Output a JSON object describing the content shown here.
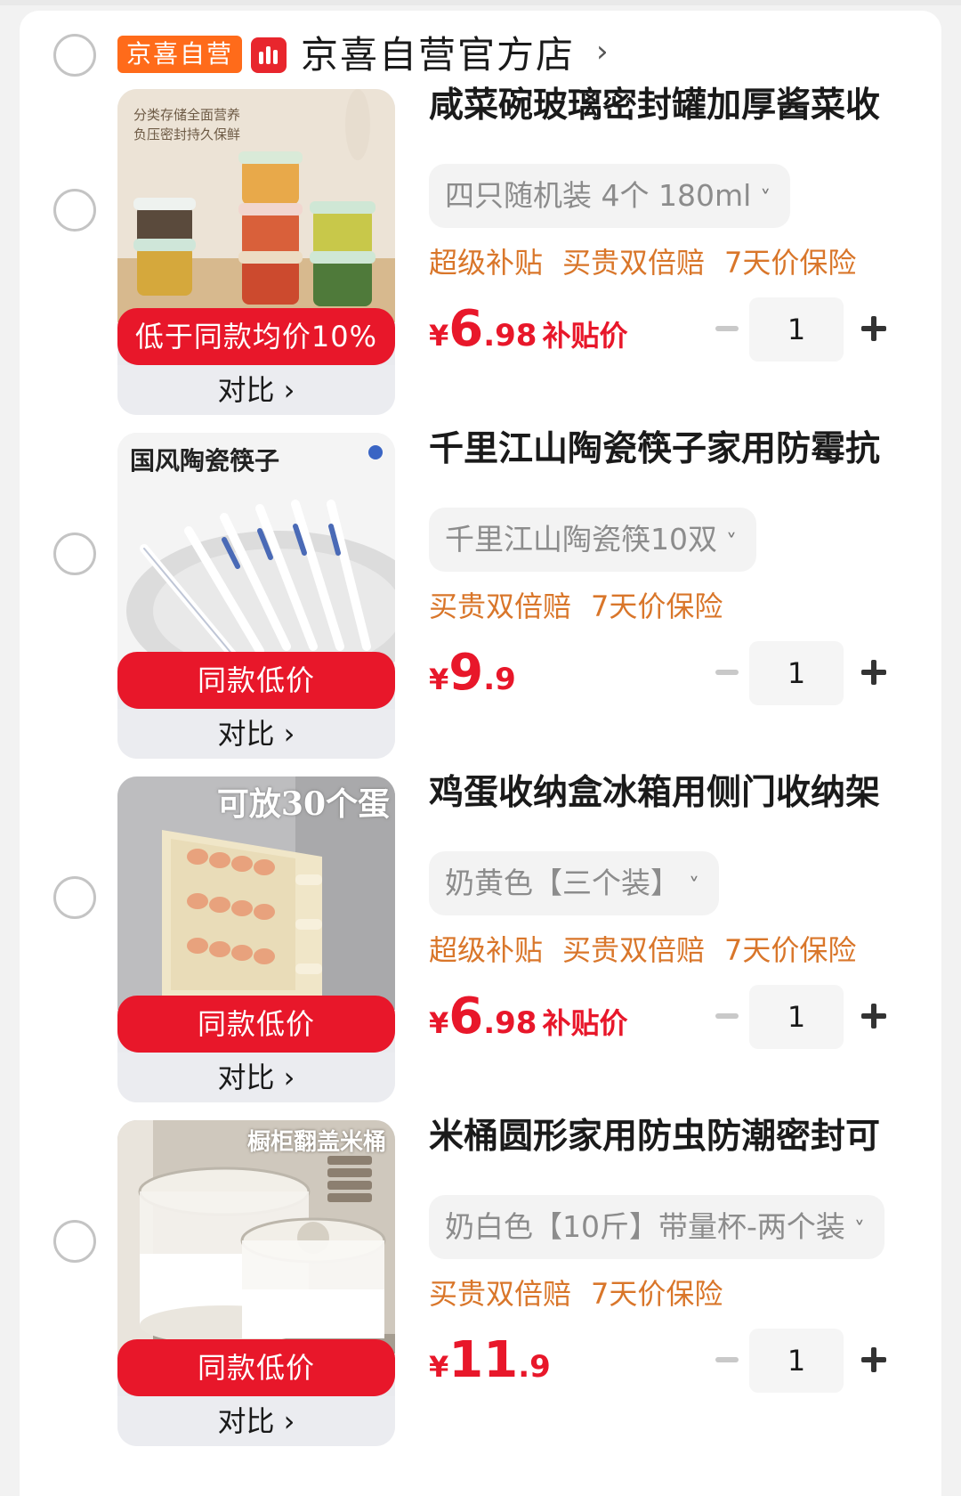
{
  "store": {
    "tag": "京喜自营",
    "name": "京喜自营官方店",
    "chevron": "›"
  },
  "items": [
    {
      "title": "咸菜碗玻璃密封罐加厚酱菜收",
      "spec": "四只随机装 4个 180ml",
      "tags": [
        "超级补贴",
        "买贵双倍赔",
        "7天价保险"
      ],
      "price_int": "6",
      "price_dec": ".98",
      "price_sub": "补贴价",
      "qty": "1",
      "banner": "低于同款均价10%",
      "compare": "对比 ›",
      "img_text": [
        "分类存储全面营养",
        "负压密封持久保鲜"
      ]
    },
    {
      "title": "千里江山陶瓷筷子家用防霉抗",
      "spec": "千里江山陶瓷筷10双",
      "tags": [
        "买贵双倍赔",
        "7天价保险"
      ],
      "price_int": "9",
      "price_dec": ".9",
      "price_sub": "",
      "qty": "1",
      "banner": "同款低价",
      "compare": "对比 ›",
      "img_text": [
        "国风陶瓷筷子"
      ]
    },
    {
      "title": "鸡蛋收纳盒冰箱用侧门收纳架",
      "spec": "奶黄色【三个装】",
      "tags": [
        "超级补贴",
        "买贵双倍赔",
        "7天价保险"
      ],
      "price_int": "6",
      "price_dec": ".98",
      "price_sub": "补贴价",
      "qty": "1",
      "banner": "同款低价",
      "compare": "对比 ›",
      "img_text": [
        "可放30个蛋"
      ]
    },
    {
      "title": "米桶圆形家用防虫防潮密封可",
      "spec": "奶白色【10斤】带量杯-两个装",
      "tags": [
        "买贵双倍赔",
        "7天价保险"
      ],
      "price_int": "11",
      "price_dec": ".9",
      "price_sub": "",
      "qty": "1",
      "banner": "同款低价",
      "compare": "对比 ›",
      "img_text": [
        "橱柜翻盖米桶"
      ]
    }
  ],
  "currency": "¥",
  "spec_chevron": "˅",
  "colors": {
    "accent_red": "#e8172a",
    "tag_orange": "#d9762a",
    "store_tag_bg": "#ff6b1a"
  }
}
